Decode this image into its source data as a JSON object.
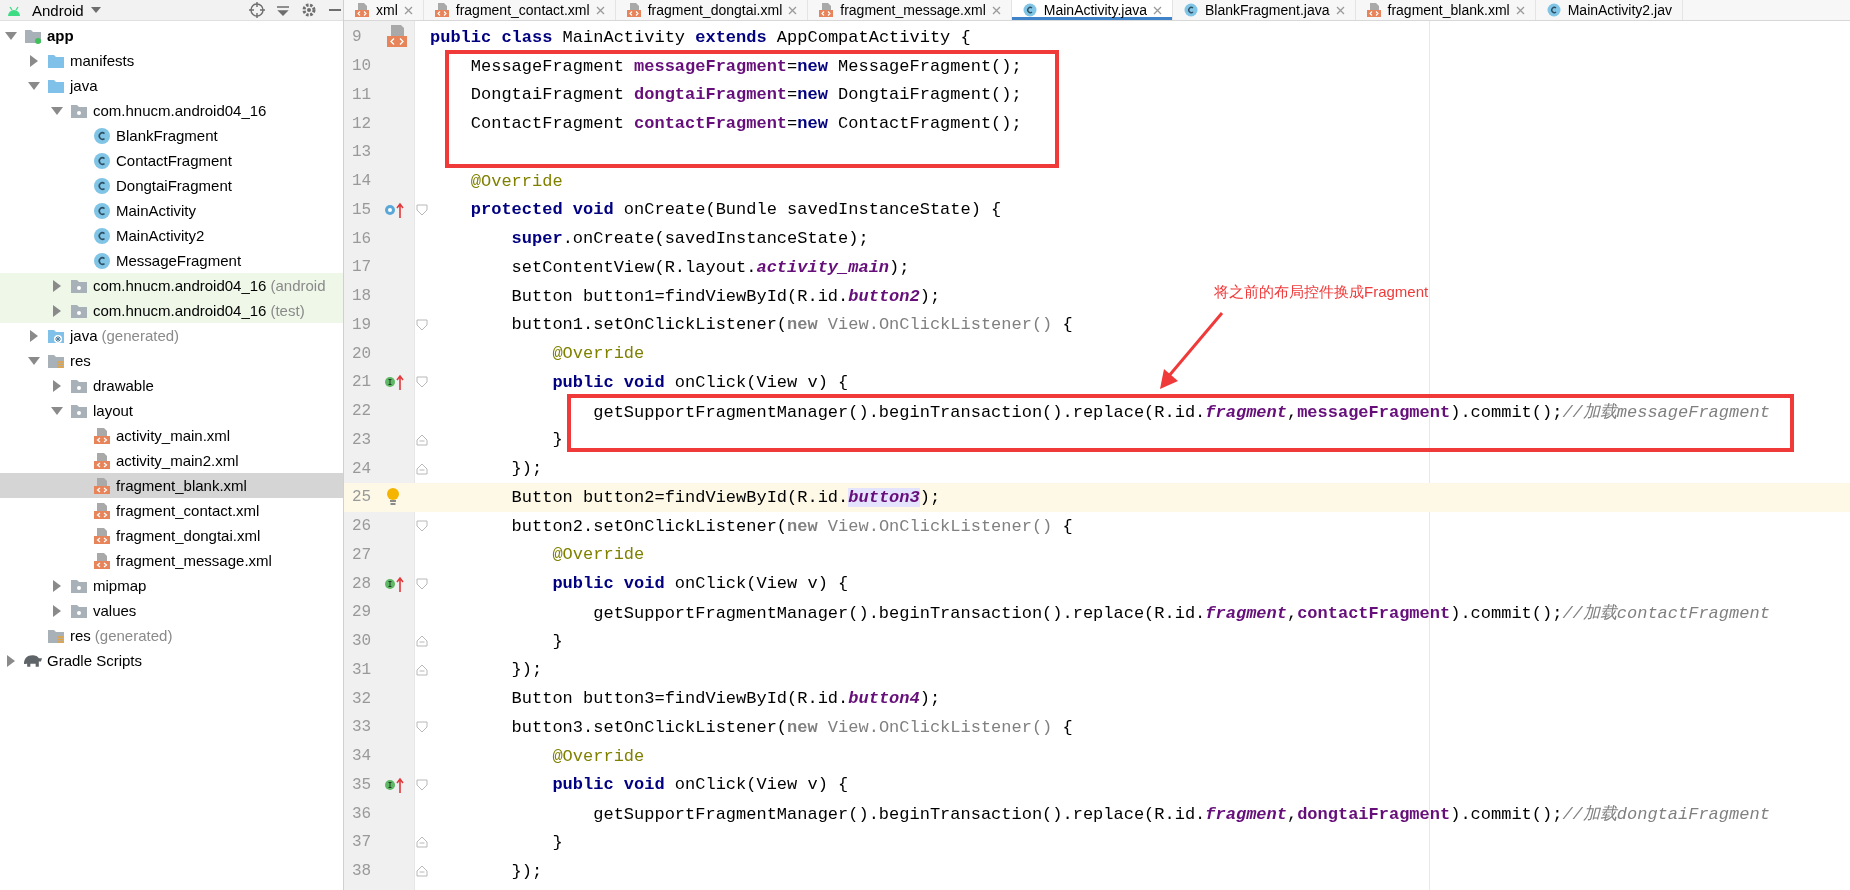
{
  "toolbar": {
    "view_label": "Android"
  },
  "tabs": [
    {
      "label": "xml",
      "kind": "xml",
      "selected": false,
      "closable": true
    },
    {
      "label": "fragment_contact.xml",
      "kind": "xml",
      "selected": false,
      "closable": true
    },
    {
      "label": "fragment_dongtai.xml",
      "kind": "xml",
      "selected": false,
      "closable": true
    },
    {
      "label": "fragment_message.xml",
      "kind": "xml",
      "selected": false,
      "closable": true
    },
    {
      "label": "MainActivity.java",
      "kind": "class",
      "selected": true,
      "closable": true
    },
    {
      "label": "BlankFragment.java",
      "kind": "class",
      "selected": false,
      "closable": true
    },
    {
      "label": "fragment_blank.xml",
      "kind": "xml",
      "selected": false,
      "closable": true
    },
    {
      "label": "MainActivity2.jav",
      "kind": "class",
      "selected": false,
      "closable": false
    }
  ],
  "project_tree": [
    {
      "label": "app",
      "kind": "module",
      "expanded": true,
      "selected": false,
      "children": [
        {
          "label": "manifests",
          "kind": "folder",
          "expanded": false,
          "selected": false
        },
        {
          "label": "java",
          "kind": "folder",
          "expanded": true,
          "selected": false,
          "children": [
            {
              "label": "com.hnucm.android04_16",
              "kind": "package",
              "expanded": true,
              "selected": false,
              "children": [
                {
                  "label": "BlankFragment",
                  "kind": "class",
                  "selected": false
                },
                {
                  "label": "ContactFragment",
                  "kind": "class",
                  "selected": false
                },
                {
                  "label": "DongtaiFragment",
                  "kind": "class",
                  "selected": false
                },
                {
                  "label": "MainActivity",
                  "kind": "class",
                  "selected": false
                },
                {
                  "label": "MainActivity2",
                  "kind": "class",
                  "selected": false
                },
                {
                  "label": "MessageFragment",
                  "kind": "class",
                  "selected": false
                }
              ]
            },
            {
              "label": "com.hnucm.android04_16",
              "note": "(android",
              "kind": "test-package",
              "expanded": false,
              "selected": false
            },
            {
              "label": "com.hnucm.android04_16",
              "note": "(test)",
              "kind": "test-package",
              "expanded": false,
              "selected": false
            }
          ]
        },
        {
          "label": "java",
          "note": "(generated)",
          "kind": "generated-folder",
          "expanded": false,
          "selected": false
        },
        {
          "label": "res",
          "kind": "res-folder",
          "expanded": true,
          "selected": false,
          "children": [
            {
              "label": "drawable",
              "kind": "package",
              "expanded": false,
              "selected": false
            },
            {
              "label": "layout",
              "kind": "package",
              "expanded": true,
              "selected": false,
              "children": [
                {
                  "label": "activity_main.xml",
                  "kind": "xml",
                  "selected": false
                },
                {
                  "label": "activity_main2.xml",
                  "kind": "xml",
                  "selected": false
                },
                {
                  "label": "fragment_blank.xml",
                  "kind": "xml",
                  "selected": true
                },
                {
                  "label": "fragment_contact.xml",
                  "kind": "xml",
                  "selected": false
                },
                {
                  "label": "fragment_dongtai.xml",
                  "kind": "xml",
                  "selected": false
                },
                {
                  "label": "fragment_message.xml",
                  "kind": "xml",
                  "selected": false
                }
              ]
            },
            {
              "label": "mipmap",
              "kind": "package",
              "expanded": false,
              "selected": false
            },
            {
              "label": "values",
              "kind": "package",
              "expanded": false,
              "selected": false
            }
          ]
        },
        {
          "label": "res",
          "note": "(generated)",
          "kind": "res-leaf",
          "selected": false
        }
      ]
    },
    {
      "label": "Gradle Scripts",
      "kind": "gradle",
      "expanded": false,
      "selected": false
    }
  ],
  "editor": {
    "lines": [
      {
        "number": "9",
        "marker": {
          "kind": "xml-file"
        },
        "current": false,
        "tokens": [
          {
            "kind": "keyword",
            "text": "public class"
          },
          {
            "kind": "plain",
            "text": " MainActivity "
          },
          {
            "kind": "keyword",
            "text": "extends"
          },
          {
            "kind": "plain",
            "text": " AppCompatActivity {"
          }
        ]
      },
      {
        "number": "10",
        "current": false,
        "tokens": [
          {
            "kind": "plain",
            "text": "    MessageFragment "
          },
          {
            "kind": "field",
            "text": "messageFragment"
          },
          {
            "kind": "plain",
            "text": "="
          },
          {
            "kind": "keyword",
            "text": "new"
          },
          {
            "kind": "plain",
            "text": " MessageFragment();"
          }
        ]
      },
      {
        "number": "11",
        "current": false,
        "tokens": [
          {
            "kind": "plain",
            "text": "    DongtaiFragment "
          },
          {
            "kind": "field",
            "text": "dongtaiFragment"
          },
          {
            "kind": "plain",
            "text": "="
          },
          {
            "kind": "keyword",
            "text": "new"
          },
          {
            "kind": "plain",
            "text": " DongtaiFragment();"
          }
        ]
      },
      {
        "number": "12",
        "current": false,
        "tokens": [
          {
            "kind": "plain",
            "text": "    ContactFragment "
          },
          {
            "kind": "field",
            "text": "contactFragment"
          },
          {
            "kind": "plain",
            "text": "="
          },
          {
            "kind": "keyword",
            "text": "new"
          },
          {
            "kind": "plain",
            "text": " ContactFragment();"
          }
        ]
      },
      {
        "number": "13",
        "current": false
      },
      {
        "number": "14",
        "current": false,
        "tokens": [
          {
            "kind": "annotation",
            "text": "    @Override"
          }
        ]
      },
      {
        "number": "15",
        "marker": {
          "kind": "override"
        },
        "fold": {
          "kind": "start"
        },
        "current": false,
        "tokens": [
          {
            "kind": "keyword",
            "text": "    protected void"
          },
          {
            "kind": "plain",
            "text": " onCreate(Bundle savedInstanceState) {"
          }
        ]
      },
      {
        "number": "16",
        "current": false,
        "tokens": [
          {
            "kind": "keyword",
            "text": "        super"
          },
          {
            "kind": "plain",
            "text": ".onCreate(savedInstanceState);"
          }
        ]
      },
      {
        "number": "17",
        "current": false,
        "tokens": [
          {
            "kind": "plain",
            "text": "        setContentView(R.layout."
          },
          {
            "kind": "static",
            "text": "activity_main"
          },
          {
            "kind": "plain",
            "text": ");"
          }
        ]
      },
      {
        "number": "18",
        "current": false,
        "tokens": [
          {
            "kind": "plain",
            "text": "        Button button1=findViewById(R.id."
          },
          {
            "kind": "static",
            "text": "button2"
          },
          {
            "kind": "plain",
            "text": ");"
          }
        ]
      },
      {
        "number": "19",
        "fold": {
          "kind": "start"
        },
        "current": false,
        "tokens": [
          {
            "kind": "plain",
            "text": "        button1.setOnClickListener("
          },
          {
            "kind": "muted-keyword",
            "text": "new"
          },
          {
            "kind": "muted",
            "text": " View.OnClickListener()"
          },
          {
            "kind": "plain",
            "text": " {"
          }
        ]
      },
      {
        "number": "20",
        "current": false,
        "tokens": [
          {
            "kind": "annotation",
            "text": "            @Override"
          }
        ]
      },
      {
        "number": "21",
        "marker": {
          "kind": "implements"
        },
        "fold": {
          "kind": "start"
        },
        "current": false,
        "tokens": [
          {
            "kind": "keyword",
            "text": "            public void"
          },
          {
            "kind": "plain",
            "text": " onClick(View v) {"
          }
        ]
      },
      {
        "number": "22",
        "current": false,
        "tokens": [
          {
            "kind": "plain",
            "text": "                getSupportFragmentManager().beginTransaction().replace(R.id."
          },
          {
            "kind": "static",
            "text": "fragment"
          },
          {
            "kind": "plain",
            "text": ","
          },
          {
            "kind": "field",
            "text": "messageFragment"
          },
          {
            "kind": "plain",
            "text": ").commit();"
          },
          {
            "kind": "comment",
            "text": "//加载messageFragment"
          }
        ]
      },
      {
        "number": "23",
        "fold": {
          "kind": "end"
        },
        "current": false,
        "tokens": [
          {
            "kind": "plain",
            "text": "            }"
          }
        ]
      },
      {
        "number": "24",
        "fold": {
          "kind": "end"
        },
        "current": false,
        "tokens": [
          {
            "kind": "plain",
            "text": "        });"
          }
        ]
      },
      {
        "number": "25",
        "marker": {
          "kind": "bulb"
        },
        "current": true,
        "tokens": [
          {
            "kind": "plain",
            "text": "        Button button2=findViewById(R.id."
          },
          {
            "kind": "static-marked",
            "text": "button3"
          },
          {
            "kind": "plain",
            "text": ");"
          }
        ]
      },
      {
        "number": "26",
        "fold": {
          "kind": "start"
        },
        "current": false,
        "tokens": [
          {
            "kind": "plain",
            "text": "        button2.setOnClickListener("
          },
          {
            "kind": "muted-keyword",
            "text": "new"
          },
          {
            "kind": "muted",
            "text": " View.OnClickListener()"
          },
          {
            "kind": "plain",
            "text": " {"
          }
        ]
      },
      {
        "number": "27",
        "current": false,
        "tokens": [
          {
            "kind": "annotation",
            "text": "            @Override"
          }
        ]
      },
      {
        "number": "28",
        "marker": {
          "kind": "implements"
        },
        "fold": {
          "kind": "start"
        },
        "current": false,
        "tokens": [
          {
            "kind": "keyword",
            "text": "            public void"
          },
          {
            "kind": "plain",
            "text": " onClick(View v) {"
          }
        ]
      },
      {
        "number": "29",
        "current": false,
        "tokens": [
          {
            "kind": "plain",
            "text": "                getSupportFragmentManager().beginTransaction().replace(R.id."
          },
          {
            "kind": "static",
            "text": "fragment"
          },
          {
            "kind": "plain",
            "text": ","
          },
          {
            "kind": "field",
            "text": "contactFragment"
          },
          {
            "kind": "plain",
            "text": ").commit();"
          },
          {
            "kind": "comment",
            "text": "//加载contactFragment"
          }
        ]
      },
      {
        "number": "30",
        "fold": {
          "kind": "end"
        },
        "current": false,
        "tokens": [
          {
            "kind": "plain",
            "text": "            }"
          }
        ]
      },
      {
        "number": "31",
        "fold": {
          "kind": "end"
        },
        "current": false,
        "tokens": [
          {
            "kind": "plain",
            "text": "        });"
          }
        ]
      },
      {
        "number": "32",
        "current": false,
        "tokens": [
          {
            "kind": "plain",
            "text": "        Button button3=findViewById(R.id."
          },
          {
            "kind": "static",
            "text": "button4"
          },
          {
            "kind": "plain",
            "text": ");"
          }
        ]
      },
      {
        "number": "33",
        "fold": {
          "kind": "start"
        },
        "current": false,
        "tokens": [
          {
            "kind": "plain",
            "text": "        button3.setOnClickListener("
          },
          {
            "kind": "muted-keyword",
            "text": "new"
          },
          {
            "kind": "muted",
            "text": " View.OnClickListener()"
          },
          {
            "kind": "plain",
            "text": " {"
          }
        ]
      },
      {
        "number": "34",
        "current": false,
        "tokens": [
          {
            "kind": "annotation",
            "text": "            @Override"
          }
        ]
      },
      {
        "number": "35",
        "marker": {
          "kind": "implements"
        },
        "fold": {
          "kind": "start"
        },
        "current": false,
        "tokens": [
          {
            "kind": "keyword",
            "text": "            public void"
          },
          {
            "kind": "plain",
            "text": " onClick(View v) {"
          }
        ]
      },
      {
        "number": "36",
        "current": false,
        "tokens": [
          {
            "kind": "plain",
            "text": "                getSupportFragmentManager().beginTransaction().replace(R.id."
          },
          {
            "kind": "static",
            "text": "fragment"
          },
          {
            "kind": "plain",
            "text": ","
          },
          {
            "kind": "field",
            "text": "dongtaiFragment"
          },
          {
            "kind": "plain",
            "text": ").commit();"
          },
          {
            "kind": "comment",
            "text": "//加载dongtaiFragment"
          }
        ]
      },
      {
        "number": "37",
        "fold": {
          "kind": "end"
        },
        "current": false,
        "tokens": [
          {
            "kind": "plain",
            "text": "            }"
          }
        ]
      },
      {
        "number": "38",
        "fold": {
          "kind": "end"
        },
        "current": false,
        "tokens": [
          {
            "kind": "plain",
            "text": "        });"
          }
        ]
      }
    ],
    "callout": {
      "text": "将之前的布局控件换成Fragment"
    }
  }
}
